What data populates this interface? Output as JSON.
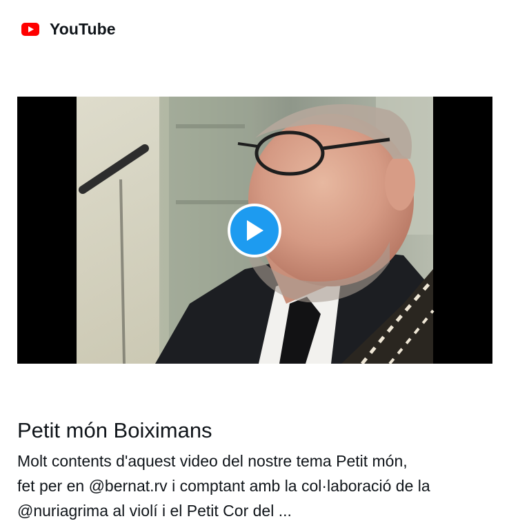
{
  "source": {
    "name": "YouTube",
    "icon": "youtube-logo-icon",
    "logo_color": "#ff0000"
  },
  "video": {
    "play_icon": "play-icon",
    "play_color": "#1d9bf0"
  },
  "title": "Petit món Boiximans",
  "description_lines": [
    "Molt contents d'aquest video del nostre tema Petit món,",
    "fet per en @bernat.rv i comptant amb la col·laboració de la",
    "@nuriagrima al violí i el Petit Cor del ..."
  ]
}
